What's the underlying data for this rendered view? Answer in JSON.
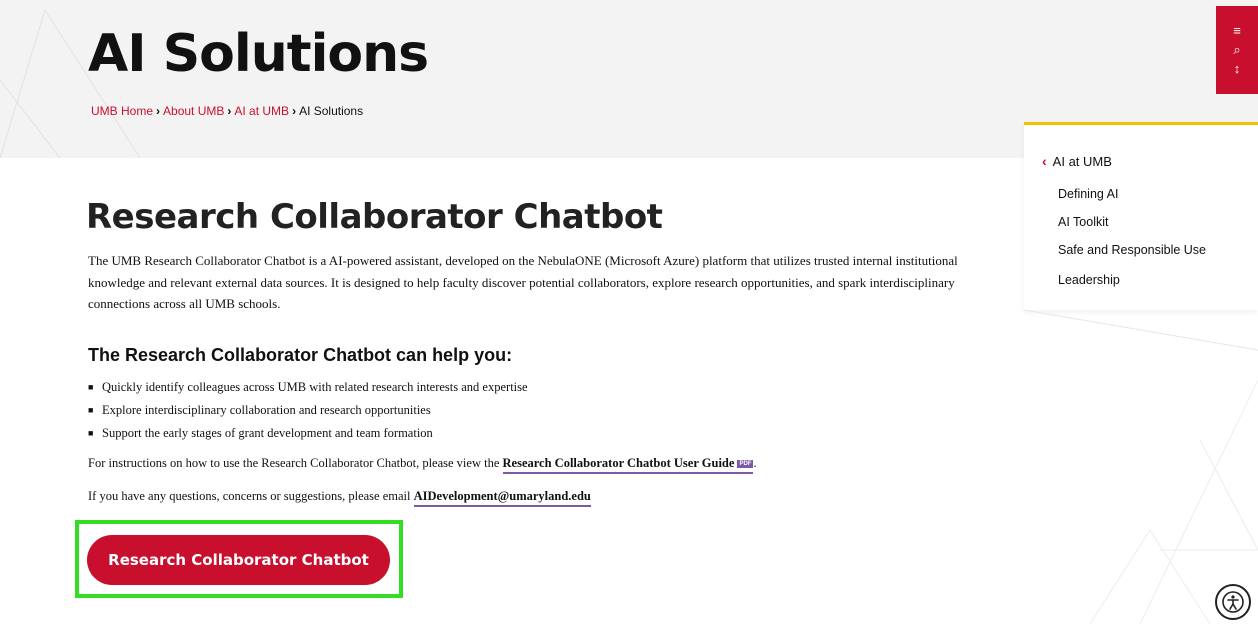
{
  "hero": {
    "title": "AI Solutions",
    "breadcrumb": [
      {
        "label": "UMB Home",
        "link": true
      },
      {
        "label": "About UMB",
        "link": true
      },
      {
        "label": "AI at UMB",
        "link": true
      },
      {
        "label": "AI Solutions",
        "link": false
      }
    ]
  },
  "utility": {
    "menu_icon": "≡",
    "search_icon": "⌕",
    "scroll_icon": "↕"
  },
  "main": {
    "title": "Research Collaborator Chatbot",
    "intro": "The UMB Research Collaborator Chatbot is a AI-powered assistant, developed on the NebulaONE (Microsoft Azure) platform that utilizes trusted internal institutional knowledge and relevant external data sources.  It is designed to help faculty discover potential collaborators, explore research opportunities, and spark interdisciplinary connections across all UMB schools.",
    "subhead": "The Research Collaborator Chatbot can help you:",
    "bullets": [
      "Quickly identify colleagues across UMB with related research interests and expertise",
      "Explore interdisciplinary collaboration and research opportunities",
      "Support the early stages of grant development and team formation"
    ],
    "instructions_prefix": "For instructions on how to use the Research Collaborator Chatbot, please view the ",
    "guide_link": "Research Collaborator Chatbot User Guide",
    "pdf_badge": "PDF",
    "instructions_suffix": ".",
    "contact_prefix": "If you have any questions, concerns or suggestions, please email ",
    "contact_email": "AIDevelopment@umaryland.edu",
    "cta_label": "Research Collaborator Chatbot"
  },
  "sidebar": {
    "parent": "AI at UMB",
    "items": [
      "Defining AI",
      "AI Toolkit",
      "Safe and Responsible Use",
      "Leadership"
    ]
  },
  "colors": {
    "brand_red": "#c8102e",
    "accent_yellow": "#f2c200",
    "link_underline": "#7b5aa6",
    "highlight_green": "#33dd22"
  }
}
